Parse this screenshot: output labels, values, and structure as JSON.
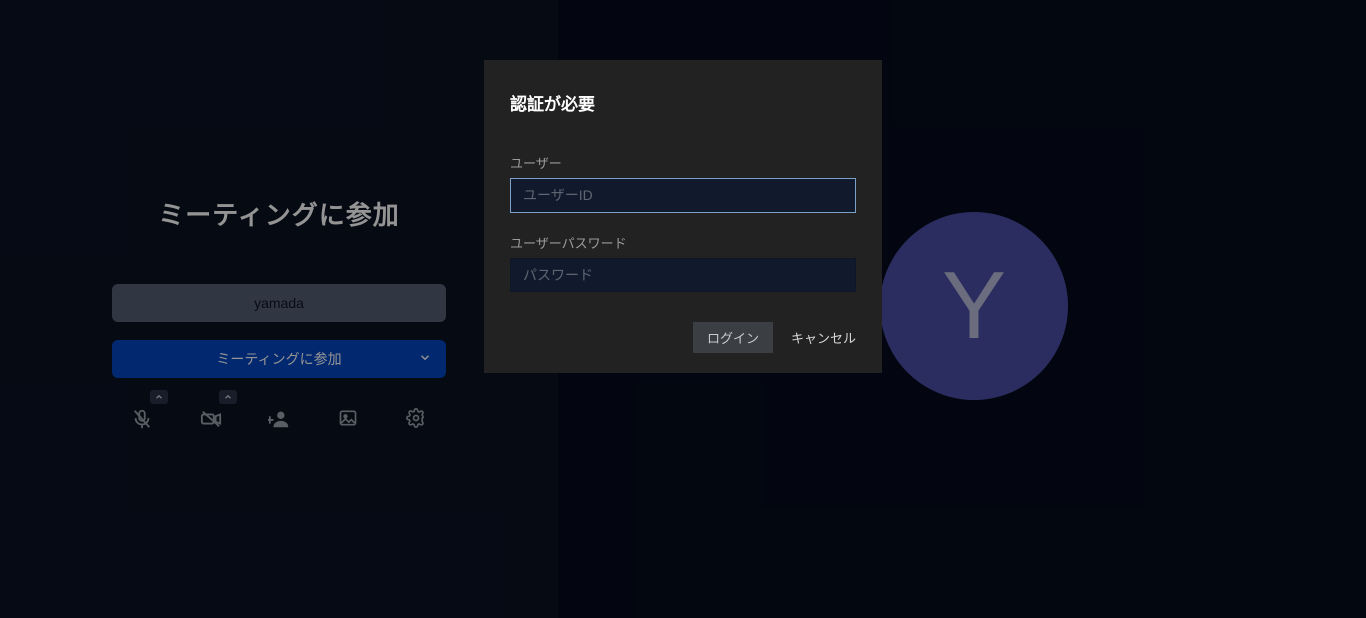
{
  "left": {
    "title": "ミーティングに参加",
    "name_value": "yamada",
    "join_label": "ミーティングに参加"
  },
  "avatar": {
    "letter": "Y"
  },
  "dialog": {
    "title": "認証が必要",
    "user_label": "ユーザー",
    "user_placeholder": "ユーザーID",
    "password_label": "ユーザーパスワード",
    "password_placeholder": "パスワード",
    "login_label": "ログイン",
    "cancel_label": "キャンセル"
  },
  "icons": {
    "mic": "microphone-off-icon",
    "camera": "camera-off-icon",
    "invite": "invite-user-icon",
    "background": "background-image-icon",
    "settings": "gear-icon"
  },
  "colors": {
    "accent": "#0445bf",
    "avatar_bg": "#4a4fa5",
    "dialog_bg": "#222222",
    "field_bg": "#111a2d"
  }
}
